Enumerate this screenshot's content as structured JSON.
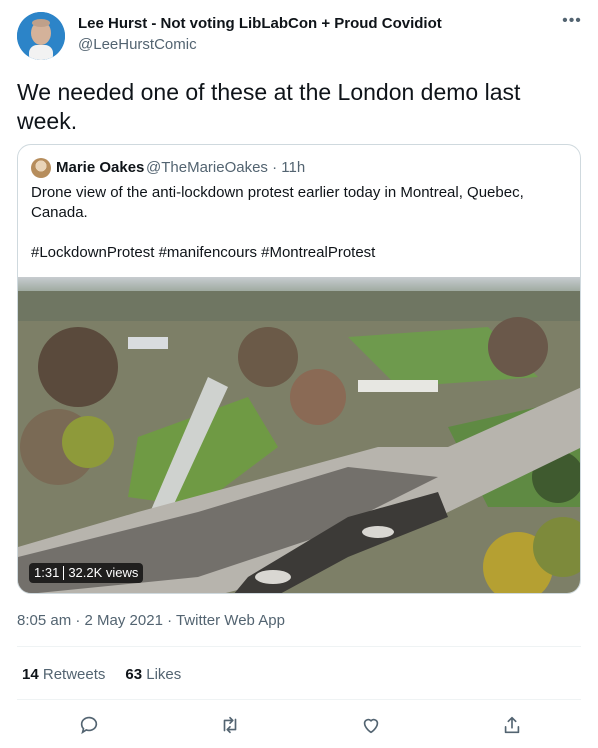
{
  "author": {
    "name": "Lee Hurst - Not voting LibLabCon + Proud Covidiot",
    "handle": "@LeeHurstComic"
  },
  "tweet": {
    "text": "We needed one of these at the London demo last week."
  },
  "quoted": {
    "name": "Marie Oakes",
    "meta": "@TheMarieOakes · 11h",
    "text": "Drone view of the anti-lockdown protest earlier today in Montreal, Quebec, Canada.\n\n#LockdownProtest #manifencours #MontrealProtest",
    "video_duration": "1:31",
    "video_views": "32.2K views"
  },
  "timestamp": "8:05 am · 2 May 2021 · Twitter Web App",
  "stats": {
    "retweets_count": "14",
    "retweets_label": "Retweets",
    "likes_count": "63",
    "likes_label": "Likes"
  },
  "icons": {
    "more": "more-icon",
    "reply": "reply-icon",
    "retweet": "retweet-icon",
    "like": "like-icon",
    "share": "share-icon"
  },
  "colors": {
    "secondary_text": "#536471",
    "border": "#cfd9de"
  }
}
